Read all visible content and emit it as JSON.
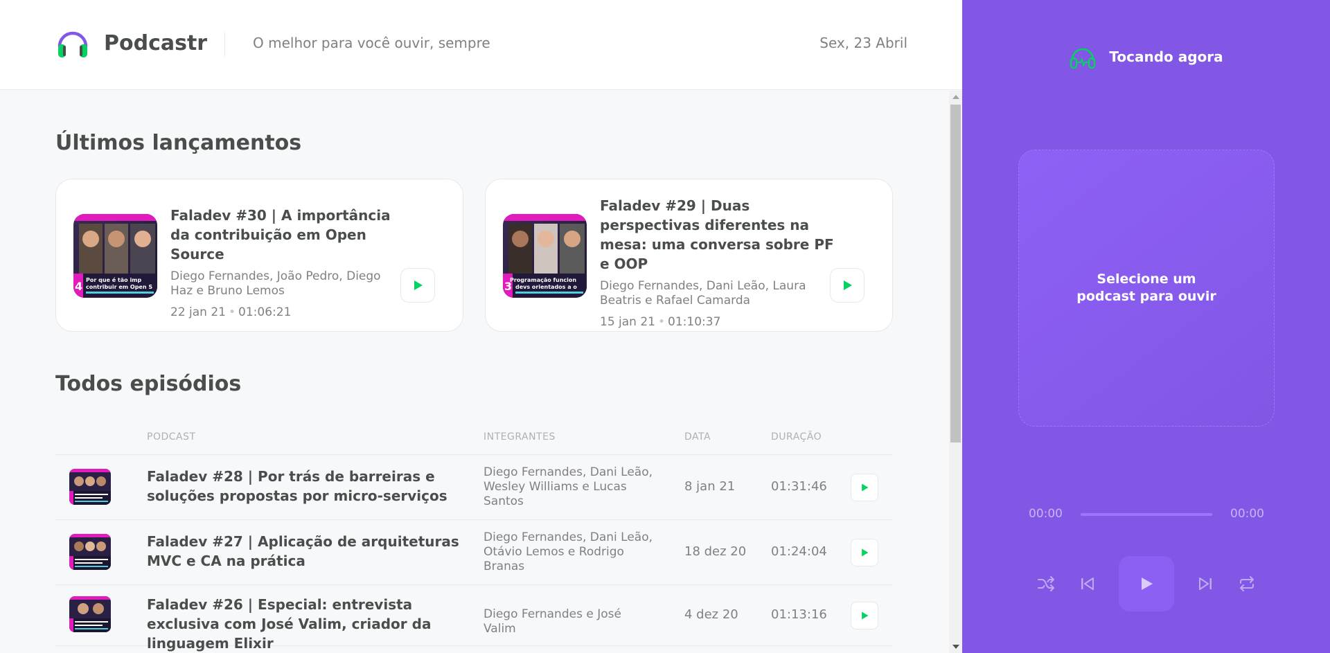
{
  "header": {
    "logo_text": "Podcastr",
    "tagline": "O melhor para você ouvir, sempre",
    "date": "Sex, 23 Abril"
  },
  "latest": {
    "heading": "Últimos lançamentos",
    "episodes": [
      {
        "title": "Faladev #30 | A importância da contribuição em Open Source",
        "members": "Diego Fernandes, João Pedro, Diego Haz e Bruno Lemos",
        "published": "22 jan 21",
        "duration": "01:06:21",
        "thumb_caption": "Por que é tão imp contribuir em Open S",
        "thumb_number": "4"
      },
      {
        "title": "Faladev #29 | Duas perspectivas diferentes na mesa: uma conversa sobre PF e OOP",
        "members": "Diego Fernandes, Dani Leão, Laura Beatris e Rafael Camarda",
        "published": "15 jan 21",
        "duration": "01:10:37",
        "thumb_caption": "Programação funcion devs orientados a o",
        "thumb_number": "3"
      }
    ]
  },
  "all": {
    "heading": "Todos episódios",
    "columns": [
      "PODCAST",
      "INTEGRANTES",
      "DATA",
      "DURAÇÃO"
    ],
    "rows": [
      {
        "title": "Faladev #28 | Por trás de barreiras e soluções propostas por micro-serviços",
        "members": "Diego Fernandes, Dani Leão, Wesley Williams e Lucas Santos",
        "date": "8 jan 21",
        "duration": "01:31:46"
      },
      {
        "title": "Faladev #27 | Aplicação de arquiteturas MVC e CA na prática",
        "members": "Diego Fernandes, Dani Leão, Otávio Lemos e Rodrigo Branas",
        "date": "18 dez 20",
        "duration": "01:24:04"
      },
      {
        "title": "Faladev #26 | Especial: entrevista exclusiva com José Valim, criador da linguagem Elixir",
        "members": "Diego Fernandes e José Valim",
        "date": "4 dez 20",
        "duration": "01:13:16"
      }
    ]
  },
  "player": {
    "heading": "Tocando agora",
    "empty_text": "Selecione um podcast para ouvir",
    "current_time": "00:00",
    "total_time": "00:00"
  },
  "colors": {
    "accent_purple": "#8257e5",
    "play_green": "#04d361",
    "text_dark": "#494d4b",
    "text_muted": "#808080"
  }
}
